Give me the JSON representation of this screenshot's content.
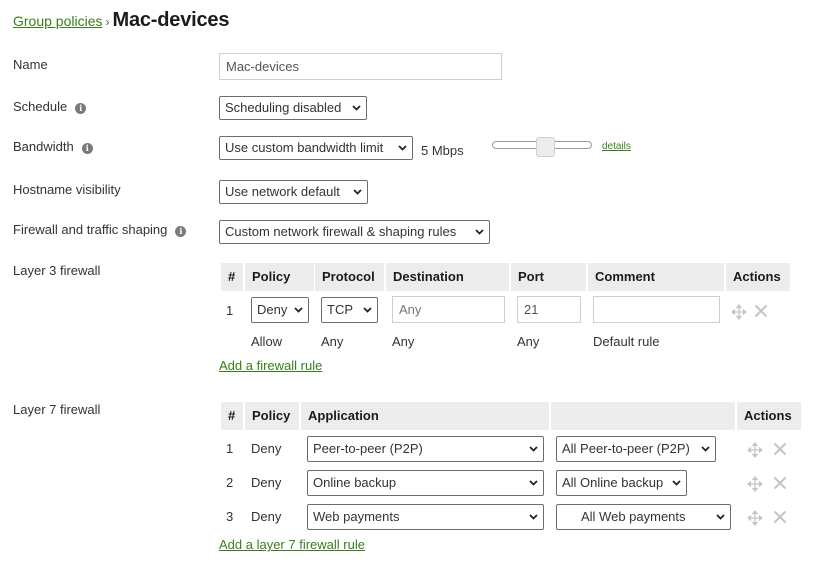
{
  "breadcrumb": {
    "parent": "Group policies",
    "separator": "›",
    "title": "Mac-devices"
  },
  "form": {
    "name": {
      "label": "Name",
      "value": "Mac-devices"
    },
    "schedule": {
      "label": "Schedule",
      "info_icon": "info-icon",
      "selected": "Scheduling disabled"
    },
    "bandwidth": {
      "label": "Bandwidth",
      "info_icon": "info-icon",
      "selected": "Use custom bandwidth limit",
      "limit_text": "5 Mbps",
      "slider_value_fraction": 0.5,
      "details_link": "details"
    },
    "hostname": {
      "label": "Hostname visibility",
      "selected": "Use network default"
    },
    "firewall_shaping": {
      "label": "Firewall and traffic shaping",
      "info_icon": "info-icon",
      "selected": "Custom network firewall & shaping rules"
    }
  },
  "layer3": {
    "label": "Layer 3 firewall",
    "headers": [
      "#",
      "Policy",
      "Protocol",
      "Destination",
      "Port",
      "Comment",
      "Actions"
    ],
    "rules": [
      {
        "num": "1",
        "policy": "Deny",
        "protocol": "TCP",
        "destination_placeholder": "Any",
        "port": "21",
        "comment": ""
      }
    ],
    "default_rule": {
      "policy": "Allow",
      "protocol": "Any",
      "destination": "Any",
      "port": "Any",
      "comment": "Default rule"
    },
    "add_link": "Add a firewall rule",
    "action_icons": [
      "move-icon",
      "close-icon"
    ]
  },
  "layer7": {
    "label": "Layer 7 firewall",
    "headers": [
      "#",
      "Policy",
      "Application",
      "",
      "Actions"
    ],
    "rules": [
      {
        "num": "1",
        "policy": "Deny",
        "application": "Peer-to-peer (P2P)",
        "category": "All Peer-to-peer (P2P)"
      },
      {
        "num": "2",
        "policy": "Deny",
        "application": "Online backup",
        "category": "All Online backup"
      },
      {
        "num": "3",
        "policy": "Deny",
        "application": "Web payments",
        "category": "All Web payments"
      }
    ],
    "add_link": "Add a layer 7 firewall rule",
    "action_icons": [
      "move-icon",
      "close-icon"
    ]
  },
  "colors": {
    "link": "#3a7d1e",
    "header_bg": "#ececec",
    "icon_gray": "#c4c4c4"
  }
}
